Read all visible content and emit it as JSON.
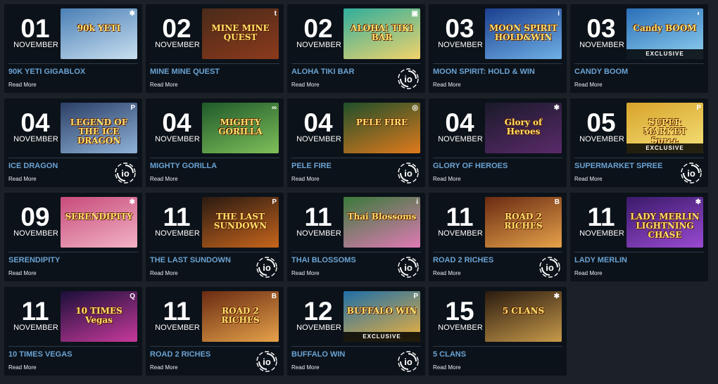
{
  "read_more_label": "Read More",
  "colors": {
    "background": "#1c2127",
    "card": "#0c1219",
    "title": "#6aa3d4"
  },
  "cards": [
    {
      "day": "01",
      "month": "NOVEMBER",
      "name": "90K YETI GIGABLOX",
      "thumb_text": "90k YETI",
      "thumb_bg": "#4a7fb5,#c9dff0",
      "corner": "✱",
      "badge": "",
      "provider_icon": false
    },
    {
      "day": "02",
      "month": "NOVEMBER",
      "name": "MINE MINE QUEST",
      "thumb_text": "MINE MINE QUEST",
      "thumb_bg": "#4a2a1a,#8b3a1c",
      "corner": "t",
      "badge": "",
      "provider_icon": false
    },
    {
      "day": "02",
      "month": "NOVEMBER",
      "name": "ALOHA TIKI BAR",
      "thumb_text": "ALOHA! TIKI BAR",
      "thumb_bg": "#2fae9c,#f2d36b",
      "corner": "▣",
      "badge": "",
      "provider_icon": true
    },
    {
      "day": "03",
      "month": "NOVEMBER",
      "name": "MOON SPIRIT: HOLD & WIN",
      "thumb_text": "MOON SPIRIT HOLD&WIN",
      "thumb_bg": "#1b3f8f,#6fb0e6",
      "corner": "i",
      "badge": "",
      "provider_icon": false
    },
    {
      "day": "03",
      "month": "NOVEMBER",
      "name": "CANDY BOOM",
      "thumb_text": "Candy BOOM",
      "thumb_bg": "#2a6fb8,#8fd0f0",
      "corner": "◐",
      "badge": "EXCLUSIVE",
      "provider_icon": false
    },
    {
      "day": "04",
      "month": "NOVEMBER",
      "name": "ICE DRAGON",
      "thumb_text": "LEGEND OF THE ICE DRAGON",
      "thumb_bg": "#2b3f66,#8fb2d8",
      "corner": "P",
      "badge": "",
      "provider_icon": true
    },
    {
      "day": "04",
      "month": "NOVEMBER",
      "name": "MIGHTY GORILLA",
      "thumb_text": "MIGHTY GORILLA",
      "thumb_bg": "#1f5a2a,#7fbf5a",
      "corner": "∞",
      "badge": "",
      "provider_icon": false
    },
    {
      "day": "04",
      "month": "NOVEMBER",
      "name": "PELE FIRE",
      "thumb_text": "PELE FIRE",
      "thumb_bg": "#1f4f2a,#e07a1c",
      "corner": "◎",
      "badge": "",
      "provider_icon": true
    },
    {
      "day": "04",
      "month": "NOVEMBER",
      "name": "GLORY OF HEROES",
      "thumb_text": "Glory of Heroes",
      "thumb_bg": "#1a1a2a,#5a2a6a",
      "corner": "✱",
      "badge": "",
      "provider_icon": false
    },
    {
      "day": "05",
      "month": "NOVEMBER",
      "name": "SUPERMARKET SPREE",
      "thumb_text": "SUPER MARKET Spree",
      "thumb_bg": "#d7a32a,#f6e27a",
      "corner": "P",
      "badge": "EXCLUSIVE",
      "provider_icon": true
    },
    {
      "day": "09",
      "month": "NOVEMBER",
      "name": "SERENDIPITY",
      "thumb_text": "SERENDIPITY",
      "thumb_bg": "#c74b7a,#f2b3c6",
      "corner": "✱",
      "badge": "",
      "provider_icon": false
    },
    {
      "day": "11",
      "month": "NOVEMBER",
      "name": "THE LAST SUNDOWN",
      "thumb_text": "THE LAST SUNDOWN",
      "thumb_bg": "#2a1a12,#c7651c",
      "corner": "P",
      "badge": "",
      "provider_icon": true
    },
    {
      "day": "11",
      "month": "NOVEMBER",
      "name": "THAI BLOSSOMS",
      "thumb_text": "Thai Blossoms",
      "thumb_bg": "#3a7a3a,#e07ab5",
      "corner": "i",
      "badge": "",
      "provider_icon": true
    },
    {
      "day": "11",
      "month": "NOVEMBER",
      "name": "ROAD 2 RICHES",
      "thumb_text": "ROAD 2 RICHES",
      "thumb_bg": "#6a2a12,#e6a24a",
      "corner": "B",
      "badge": "",
      "provider_icon": true
    },
    {
      "day": "11",
      "month": "NOVEMBER",
      "name": "LADY MERLIN",
      "thumb_text": "LADY MERLIN LIGHTNING CHASE",
      "thumb_bg": "#3a1a6a,#9a4ad2",
      "corner": "✱",
      "badge": "",
      "provider_icon": false
    },
    {
      "day": "11",
      "month": "NOVEMBER",
      "name": "10 TIMES VEGAS",
      "thumb_text": "10 TIMES Vegas",
      "thumb_bg": "#1a0f3a,#c73a9a",
      "corner": "Q",
      "badge": "",
      "provider_icon": false
    },
    {
      "day": "11",
      "month": "NOVEMBER",
      "name": "ROAD 2 RICHES",
      "thumb_text": "ROAD 2 RICHES",
      "thumb_bg": "#6a2a12,#e6a24a",
      "corner": "B",
      "badge": "",
      "provider_icon": true
    },
    {
      "day": "12",
      "month": "NOVEMBER",
      "name": "BUFFALO WIN",
      "thumb_text": "BUFFALO WIN",
      "thumb_bg": "#1f6fa8,#f2b23a",
      "corner": "P",
      "badge": "EXCLUSIVE",
      "provider_icon": true
    },
    {
      "day": "15",
      "month": "NOVEMBER",
      "name": "5 CLANS",
      "thumb_text": "5 CLANS",
      "thumb_bg": "#2a1a0f,#c79a4a",
      "corner": "✱",
      "badge": "",
      "provider_icon": false
    }
  ]
}
